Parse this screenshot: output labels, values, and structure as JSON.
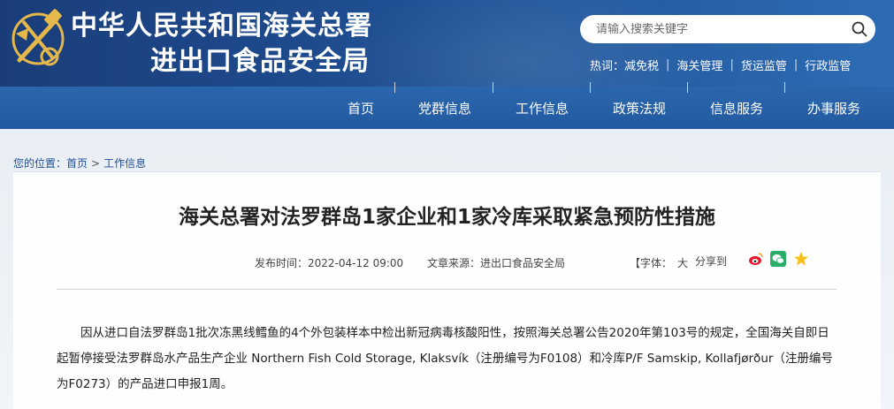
{
  "header": {
    "title_line1": "中华人民共和国海关总署",
    "title_line2": "进出口食品安全局",
    "search": {
      "placeholder": "请输入搜索关键字"
    },
    "hot": {
      "label": "热词：",
      "items": [
        "减免税",
        "海关管理",
        "货运监管",
        "行政监管"
      ]
    }
  },
  "nav": {
    "items": [
      "首页",
      "党群信息",
      "工作信息",
      "政策法规",
      "信息服务",
      "办事服务"
    ]
  },
  "breadcrumb": {
    "prefix": "您的位置：",
    "items": [
      "首页",
      "工作信息"
    ],
    "separator": ">"
  },
  "article": {
    "title": "海关总署对法罗群岛1家企业和1家冷库采取紧急预防性措施",
    "publish_label": "发布时间：",
    "publish_time": "2022-04-12 09:00",
    "source_label": "文章来源：",
    "source": "进出口食品安全局",
    "font_label": "【字体：",
    "font_size": "大",
    "share_label": "分享到",
    "body": "因从进口自法罗群岛1批次冻黑线鳕鱼的4个外包装样本中检出新冠病毒核酸阳性，按照海关总署公告2020年第103号的规定，全国海关自即日起暂停接受法罗群岛水产品生产企业 Northern Fish Cold Storage, Klaksvík（注册编号为F0108）和冷库P/F Samskip, Kollafjørður（注册编号为F0273）的产品进口申报1周。"
  },
  "colors": {
    "header_blue": "#1f4f93",
    "nav_blue": "#2b66ad",
    "text_dark": "#222222"
  }
}
